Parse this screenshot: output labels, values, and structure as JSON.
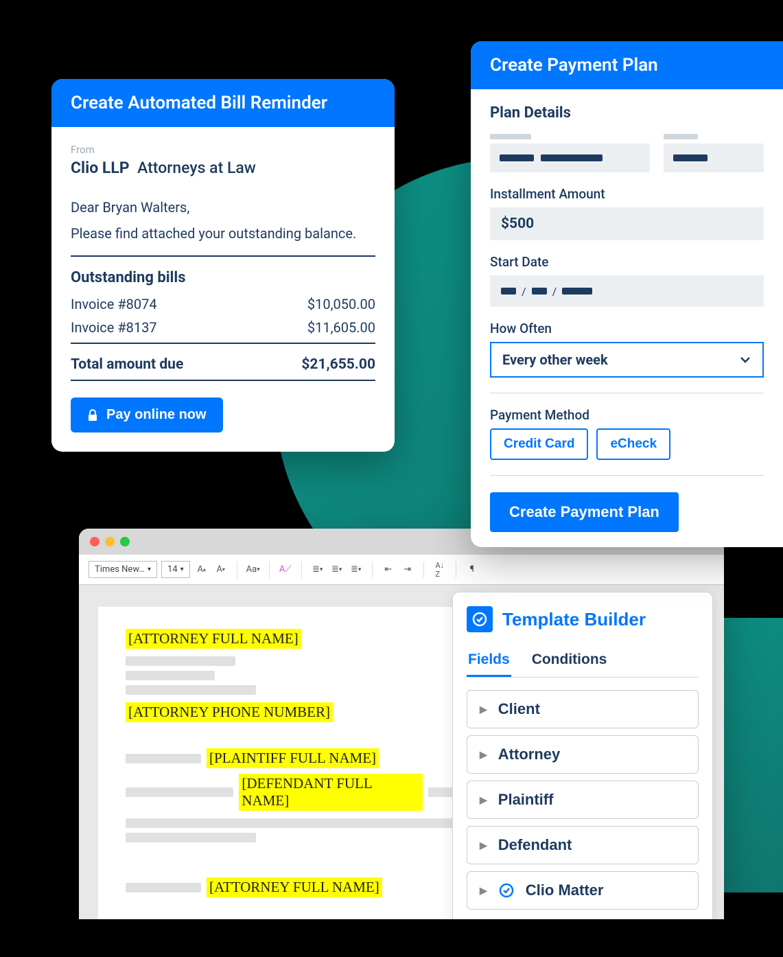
{
  "card1": {
    "title": "Create Automated Bill Reminder",
    "from_label": "From",
    "from_company": "Clio LLP",
    "from_sub": "Attorneys at Law",
    "greeting": "Dear Bryan Walters,",
    "message": "Please find attached your outstanding balance.",
    "section_title": "Outstanding bills",
    "invoices": [
      {
        "label": "Invoice #8074",
        "amount": "$10,050.00"
      },
      {
        "label": "Invoice #8137",
        "amount": "$11,605.00"
      }
    ],
    "total_label": "Total amount due",
    "total_amount": "$21,655.00",
    "pay_button": "Pay online now"
  },
  "card2": {
    "title": "Create Payment Plan",
    "plan_details": "Plan Details",
    "installment_label": "Installment Amount",
    "installment_value": "$500",
    "start_date_label": "Start Date",
    "how_often_label": "How Often",
    "how_often_value": "Every other week",
    "payment_method_label": "Payment Method",
    "chip_credit": "Credit Card",
    "chip_echeck": "eCheck",
    "create_button": "Create Payment Plan"
  },
  "editor": {
    "font_name": "Times New…",
    "font_size": "14",
    "placeholders": {
      "attorney_name": "[ATTORNEY FULL NAME]",
      "attorney_phone": "[ATTORNEY PHONE NUMBER]",
      "plaintiff_name": "[PLAINTIFF FULL NAME]",
      "defendant_name": "[DEFENDANT FULL NAME]",
      "attorney_name_2": "[ATTORNEY FULL NAME]"
    }
  },
  "panel": {
    "title": "Template Builder",
    "tab_fields": "Fields",
    "tab_conditions": "Conditions",
    "rows": [
      "Client",
      "Attorney",
      "Plaintiff",
      "Defendant",
      "Clio Matter"
    ]
  }
}
